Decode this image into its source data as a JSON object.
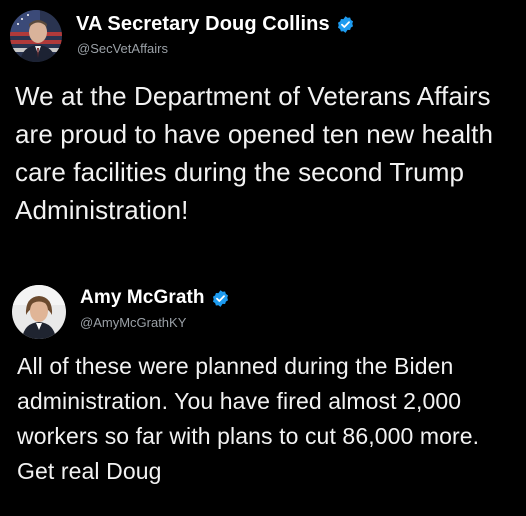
{
  "colors": {
    "background": "#000000",
    "text": "#f2f2f2",
    "secondary_text": "#9aa0a6",
    "verified": "#1d9bf0"
  },
  "main_tweet": {
    "display_name": "VA Secretary Doug Collins",
    "handle": "@SecVetAffairs",
    "verified": true,
    "verified_icon": "verified-badge-icon",
    "avatar_icon": "avatar",
    "text": "We at the Department of Veterans Affairs are proud to have opened ten new health care facilities during the second Trump Administration!"
  },
  "reply_tweet": {
    "display_name": "Amy McGrath",
    "handle": "@AmyMcGrathKY",
    "verified": true,
    "verified_icon": "verified-badge-icon",
    "avatar_icon": "avatar",
    "text": "All of these were planned during the Biden administration. You have fired almost 2,000 workers so far with plans to cut 86,000 more. Get real Doug"
  }
}
